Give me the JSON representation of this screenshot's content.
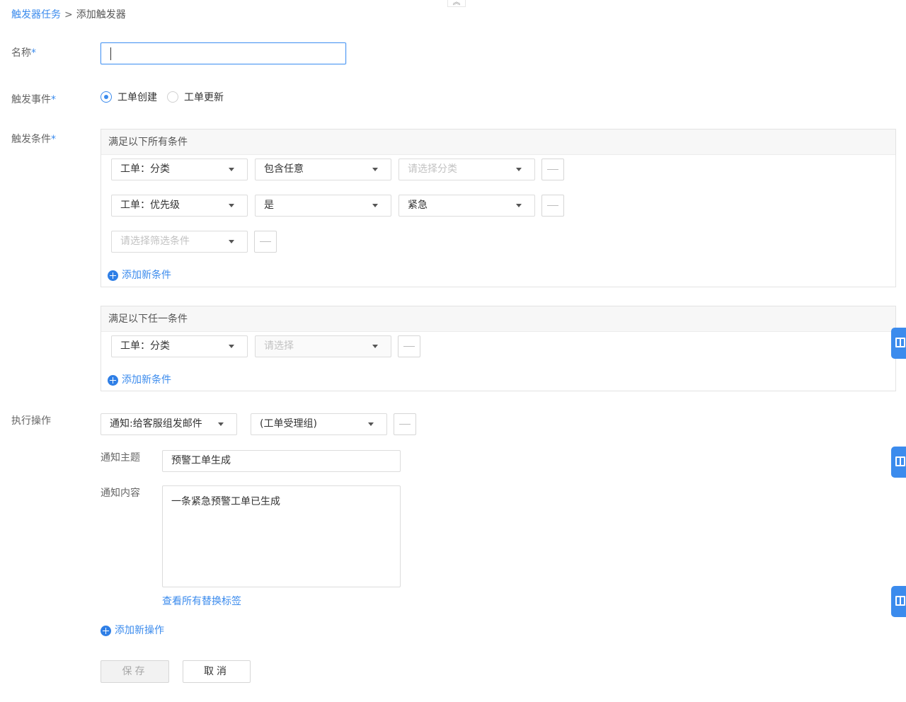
{
  "breadcrumb": {
    "parent": "触发器任务",
    "separator": ">",
    "current": "添加触发器"
  },
  "form": {
    "name": {
      "label": "名称",
      "required_mark": "*",
      "value": ""
    },
    "event": {
      "label": "触发事件",
      "required_mark": "*",
      "options": [
        {
          "label": "工单创建",
          "checked": true
        },
        {
          "label": "工单更新",
          "checked": false
        }
      ]
    },
    "conditions": {
      "label": "触发条件",
      "required_mark": "*",
      "all_group": {
        "header": "满足以下所有条件",
        "rows": [
          {
            "field": "工单：分类",
            "operator": "包含任意",
            "value": "请选择分类",
            "value_placeholder": true
          },
          {
            "field": "工单：优先级",
            "operator": "是",
            "value": "紧急",
            "value_placeholder": false
          },
          {
            "field": "请选择筛选条件",
            "field_placeholder": true
          }
        ],
        "add_label": "添加新条件"
      },
      "any_group": {
        "header": "满足以下任一条件",
        "rows": [
          {
            "field": "工单：分类",
            "operator": "请选择",
            "operator_placeholder": true
          }
        ],
        "add_label": "添加新条件"
      }
    },
    "actions": {
      "label": "执行操作",
      "action_type": "通知:给客服组发邮件",
      "target": "(工单受理组)",
      "subject_label": "通知主题",
      "subject_value": "预警工单生成",
      "content_label": "通知内容",
      "content_value": "一条紧急预警工单已生成",
      "tags_link": "查看所有替换标签",
      "add_label": "添加新操作"
    }
  },
  "buttons": {
    "save": "保存",
    "cancel": "取消"
  },
  "colors": {
    "accent": "#3b8bed",
    "border": "#dcdcdc",
    "panel_header": "#f7f7f7"
  },
  "icons": {
    "collapse": "double-chevron-up-icon",
    "side_tab": "book-icon",
    "add": "plus-circle-icon",
    "remove": "minus-icon",
    "dropdown": "caret-down-icon"
  }
}
